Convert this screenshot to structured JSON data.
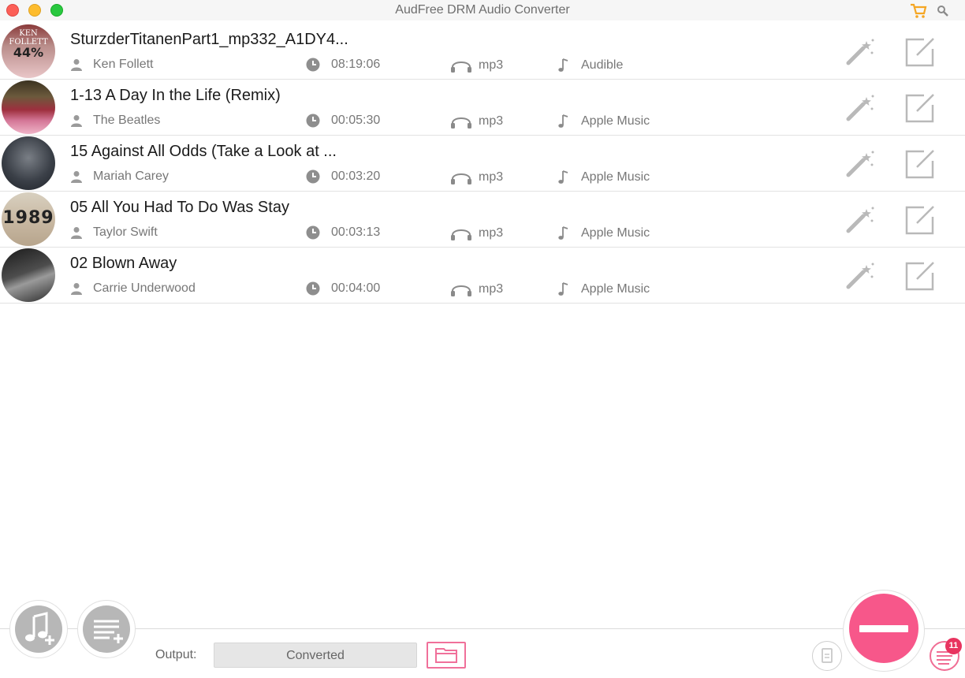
{
  "window": {
    "title": "AudFree DRM Audio Converter"
  },
  "colors": {
    "accent": "#f7578a",
    "close": "#fc5f57",
    "minimize": "#fdbc2e",
    "maximize": "#29c840",
    "cart": "#f5a623"
  },
  "tracks": [
    {
      "title": "SturzderTitanenPart1_mp332_A1DY4...",
      "artist": "Ken Follett",
      "duration": "08:19:06",
      "format": "mp3",
      "source": "Audible",
      "cover_text": "44%",
      "cover_top": "KEN FOLLETT",
      "cover_progress": 0.44
    },
    {
      "title": "1-13 A Day In the Life (Remix)",
      "artist": "The Beatles",
      "duration": "00:05:30",
      "format": "mp3",
      "source": "Apple Music"
    },
    {
      "title": "15 Against All Odds (Take a Look at ...",
      "artist": "Mariah Carey",
      "duration": "00:03:20",
      "format": "mp3",
      "source": "Apple Music"
    },
    {
      "title": "05 All You Had To Do Was Stay",
      "artist": "Taylor Swift",
      "duration": "00:03:13",
      "format": "mp3",
      "source": "Apple Music",
      "cover_text": "1989"
    },
    {
      "title": "02 Blown Away",
      "artist": "Carrie Underwood",
      "duration": "00:04:00",
      "format": "mp3",
      "source": "Apple Music"
    }
  ],
  "bottom": {
    "output_label": "Output:",
    "output_value": "Converted",
    "badge_count": "11"
  }
}
